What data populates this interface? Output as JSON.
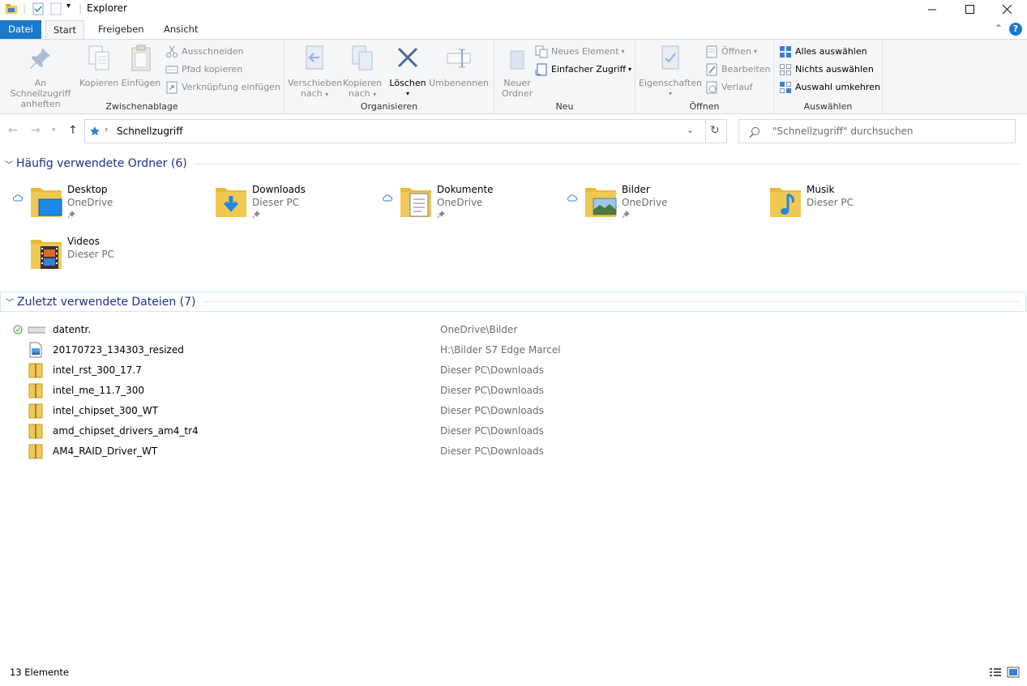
{
  "window": {
    "title": "Explorer",
    "minimize_icon": "minimize-icon",
    "maximize_icon": "maximize-icon",
    "close_icon": "close-icon"
  },
  "ribbon_tabs": [
    "Datei",
    "Start",
    "Freigeben",
    "Ansicht"
  ],
  "ribbon": {
    "clipboard": {
      "label": "Zwischenablage",
      "pin": "An Schnellzugriff anheften",
      "copy": "Kopieren",
      "paste": "Einfügen",
      "cut": "Ausschneiden",
      "copy_path": "Pfad kopieren",
      "paste_shortcut": "Verknüpfung einfügen"
    },
    "organize": {
      "label": "Organisieren",
      "move_to_1": "Verschieben",
      "move_to_2": "nach",
      "copy_to_1": "Kopieren",
      "copy_to_2": "nach",
      "delete": "Löschen",
      "rename": "Umbenennen"
    },
    "new": {
      "label": "Neu",
      "new_folder_1": "Neuer",
      "new_folder_2": "Ordner",
      "new_item": "Neues Element",
      "easy_access": "Einfacher Zugriff"
    },
    "open": {
      "label": "Öffnen",
      "properties": "Eigenschaften",
      "open": "Öffnen",
      "edit": "Bearbeiten",
      "history": "Verlauf"
    },
    "select": {
      "label": "Auswählen",
      "select_all": "Alles auswählen",
      "select_none": "Nichts auswählen",
      "invert": "Auswahl umkehren"
    }
  },
  "address": {
    "path": "Schnellzugriff",
    "search_placeholder": "\"Schnellzugriff\" durchsuchen"
  },
  "frequent": {
    "header": "Häufig verwendete Ordner (6)",
    "items": [
      {
        "name": "Desktop",
        "location": "OneDrive"
      },
      {
        "name": "Downloads",
        "location": "Dieser PC"
      },
      {
        "name": "Dokumente",
        "location": "OneDrive"
      },
      {
        "name": "Bilder",
        "location": "OneDrive"
      },
      {
        "name": "Musik",
        "location": "Dieser PC"
      },
      {
        "name": "Videos",
        "location": "Dieser PC"
      }
    ]
  },
  "recent": {
    "header": "Zuletzt verwendete Dateien (7)",
    "items": [
      {
        "name": "datentr.",
        "location": "OneDrive\\Bilder"
      },
      {
        "name": "20170723_134303_resized",
        "location": "H:\\Bilder S7 Edge Marcel"
      },
      {
        "name": "intel_rst_300_17.7",
        "location": "Dieser PC\\Downloads"
      },
      {
        "name": "intel_me_11.7_300",
        "location": "Dieser PC\\Downloads"
      },
      {
        "name": "intel_chipset_300_WT",
        "location": "Dieser PC\\Downloads"
      },
      {
        "name": "amd_chipset_drivers_am4_tr4",
        "location": "Dieser PC\\Downloads"
      },
      {
        "name": "AM4_RAID_Driver_WT",
        "location": "Dieser PC\\Downloads"
      }
    ]
  },
  "status": {
    "count": "13 Elemente"
  },
  "colors": {
    "accent": "#1979ca",
    "section_header": "#1e3287",
    "folder_yellow": "#f0c952"
  }
}
